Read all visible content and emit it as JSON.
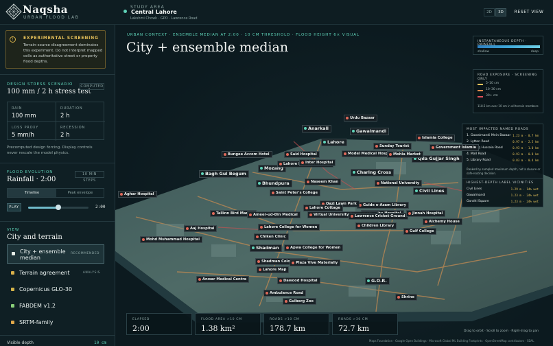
{
  "brand": {
    "name": "Naqsha",
    "subtitle": "URBAN FLOOD LAB"
  },
  "study": {
    "label": "STUDY AREA",
    "name": "Central Lahore",
    "sub": "Lakshmi Chowk · GPO · Lawrence Road"
  },
  "viewmode": {
    "two_d": "2D",
    "three_d": "3D",
    "reset": "RESET VIEW"
  },
  "warning": {
    "title": "EXPERIMENTAL SCREENING",
    "body": "Terrain-source disagreement dominates this experiment. Do not interpret mapped cells as authoritative street or property flood depths.",
    "icon": "!"
  },
  "scenario": {
    "label": "DESIGN STRESS SCENARIO",
    "title": "100 mm / 2 h stress test",
    "badge": "COMPUTED",
    "stats": [
      {
        "k": "RAIN",
        "v": "100 mm"
      },
      {
        "k": "DURATION",
        "v": "2 h"
      },
      {
        "k": "LOSS PROXY",
        "v": "5 mm/h"
      },
      {
        "k": "RECESSION",
        "v": "2 h"
      }
    ],
    "note": "Precomputed design forcing. Display controls never rescale the model physics."
  },
  "evolution": {
    "label": "FLOOD EVOLUTION",
    "title": "Rainfall · 2:00",
    "badge": "10 MIN STEPS",
    "seg_time": "Timeline",
    "seg_peak": "Peak envelope",
    "play": "PLAY",
    "slider_value": "2:00",
    "slider_fraction": 0.5
  },
  "view": {
    "label": "VIEW",
    "title": "City and terrain",
    "items": [
      {
        "name": "City + ensemble median",
        "tag": "RECOMMENDED",
        "color": "#e7eee9"
      },
      {
        "name": "Terrain agreement",
        "tag": "ANALYSIS",
        "color": "#d9b04a"
      },
      {
        "name": "Copernicus GLO-30",
        "tag": "",
        "color": "#d4b44a"
      },
      {
        "name": "FABDEM v1.2",
        "tag": "",
        "color": "#8ad07a"
      },
      {
        "name": "SRTM-family",
        "tag": "",
        "color": "#e0a84a"
      }
    ]
  },
  "visible_depth": {
    "label": "Visible depth",
    "value": "10 cm"
  },
  "map": {
    "overline": "URBAN CONTEXT · ENSEMBLE MEDIAN AT 2:00 · 10 CM THRESHOLD · FLOOD HEIGHT 6× VISUAL",
    "title": "City + ensemble median"
  },
  "depth_legend": {
    "title": "INSTANTANEOUS DEPTH · RAINFALL",
    "low": "shallow",
    "high": "deep"
  },
  "road_exposure": {
    "title": "ROAD EXPOSURE · SCREENING ONLY",
    "items": [
      {
        "label": "5–10 cm",
        "color": "#e6c25a"
      },
      {
        "label": "10–30 cm",
        "color": "#e08a4a"
      },
      {
        "label": "30+ cm",
        "color": "#e0505a"
      }
    ],
    "note": "118.5 km over 10 cm in all terrain members"
  },
  "impacted": {
    "title": "MOST IMPACTED NAMED ROADS",
    "rows": [
      {
        "n": "1. Gawalmandi Mein Bazaar",
        "v": "1.23 m · 0.7 km"
      },
      {
        "n": "2. Lytton Road",
        "v": "0.97 m · 2.5 km"
      },
      {
        "n": "3. Ashaq Hussain Road",
        "v": "0.93 m · 1.0 km"
      },
      {
        "n": "4. Mall Road",
        "v": "0.93 m · 0.8 km"
      },
      {
        "n": "5. Library Road",
        "v": "0.83 m · 0.4 km"
      }
    ],
    "note": "Ranked by sampled maximum depth, not a closure or safe-routing decision.",
    "vic_title": "HIGHEST-DEPTH LABEL VICINITIES",
    "vic": [
      {
        "n": "Civil Lines",
        "v": "1.29 m · 14% wet"
      },
      {
        "n": "Gawalmandi",
        "v": "1.23 m · 24% wet"
      },
      {
        "n": "Gandhi Square",
        "v": "1.23 m · 24% wet"
      }
    ]
  },
  "summary": [
    {
      "k": "ELAPSED",
      "v": "2:00"
    },
    {
      "k": "FLOOD AREA >10 CM",
      "v": "1.38 km²"
    },
    {
      "k": "ROADS >10 CM",
      "v": "178.7 km"
    },
    {
      "k": "ROADS >30 CM",
      "v": "72.7 km"
    }
  ],
  "hint": "Drag to orbit · Scroll to zoom · Right-drag to pan",
  "attribution": "Maps Foundation · Google Open Buildings · Microsoft Global ML Building Footprints · OpenStreetMap contributors · SDAL",
  "labels": [
    {
      "t": "Urdu Bazaar",
      "b": false
    },
    {
      "t": "Anarkali",
      "b": true
    },
    {
      "t": "Gawalmandi",
      "b": true
    },
    {
      "t": "Islamia College",
      "b": false
    },
    {
      "t": "Sunday Tourist",
      "b": false
    },
    {
      "t": "Government Islamia",
      "b": false
    },
    {
      "t": "Qila Gujjar Singh",
      "b": true
    },
    {
      "t": "Lahore",
      "b": true
    },
    {
      "t": "Bungee Accom Hotel",
      "b": false
    },
    {
      "t": "Model Medical Hospital",
      "b": false
    },
    {
      "t": "Mohla Market",
      "b": false
    },
    {
      "t": "Said Hospital",
      "b": false
    },
    {
      "t": "Mozang",
      "b": true
    },
    {
      "t": "Lahore Muslim Hospital",
      "b": false
    },
    {
      "t": "Inter Hospital",
      "b": false
    },
    {
      "t": "Bagh Gul Begum",
      "b": true
    },
    {
      "t": "Charing Cross",
      "b": true
    },
    {
      "t": "Bhundpura",
      "b": true
    },
    {
      "t": "Saint Peter's College",
      "b": false
    },
    {
      "t": "National University",
      "b": false
    },
    {
      "t": "Civil Lines",
      "b": true
    },
    {
      "t": "Naseem Khan",
      "b": false
    },
    {
      "t": "Aghar Hospital",
      "b": false
    },
    {
      "t": "Guide e-Azam Library",
      "b": false
    },
    {
      "t": "Qazi Lawn Park",
      "b": false
    },
    {
      "t": "Dr. Taha Hospital",
      "b": false
    },
    {
      "t": "Lahore Cottage",
      "b": false
    },
    {
      "t": "Al-Sharif Hospital",
      "b": false
    },
    {
      "t": "Tallinn Bird Market",
      "b": false
    },
    {
      "t": "Ameer-ud-Din Medical",
      "b": false
    },
    {
      "t": "Virtual University",
      "b": false
    },
    {
      "t": "Lawrence Cricket Ground",
      "b": false
    },
    {
      "t": "Jinnah Hospital",
      "b": false
    },
    {
      "t": "Alchemy House",
      "b": false
    },
    {
      "t": "Lahore College for Women",
      "b": false
    },
    {
      "t": "Gulf College",
      "b": false
    },
    {
      "t": "Aaj Hospital",
      "b": false
    },
    {
      "t": "Children Library",
      "b": false
    },
    {
      "t": "Mohd Muhammad Hospital",
      "b": false
    },
    {
      "t": "Chiken Clinic",
      "b": false
    },
    {
      "t": "Shadman",
      "b": true
    },
    {
      "t": "Apwa College for Women",
      "b": false
    },
    {
      "t": "Shadman Colony Park",
      "b": false
    },
    {
      "t": "Lahore Map",
      "b": false
    },
    {
      "t": "Plaza Vive Materially",
      "b": false
    },
    {
      "t": "Anwar Medical Centre",
      "b": false
    },
    {
      "t": "Dawood Hospital",
      "b": false
    },
    {
      "t": "G.O.R.",
      "b": true
    },
    {
      "t": "Ambulance Road",
      "b": false
    },
    {
      "t": "Gulberg Zoo",
      "b": false
    },
    {
      "t": "Shrine",
      "b": false
    }
  ]
}
